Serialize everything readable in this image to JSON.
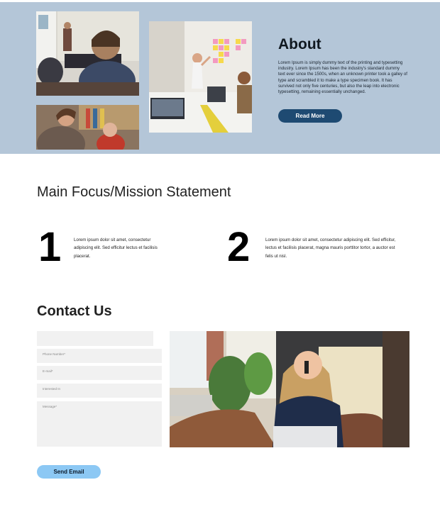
{
  "about": {
    "title": "About",
    "body": "Lorem Ipsum is simply dummy text of the printing and typesetting industry. Lorem Ipsum has been the industry's standard dummy text ever since the 1500s, when an unknown printer took a galley of type and scrambled it to make a type specimen book. It has survived not only five centuries, but also the leap into electronic typesetting, remaining essentially unchanged.",
    "button_label": "Read More"
  },
  "mission": {
    "title": "Main Focus/Mission Statement",
    "items": [
      {
        "number": "1",
        "text": "Lorem ipsum dolor sit amet, consectetur adipiscing elit. Sed efficitur lectus et facilisis placerat."
      },
      {
        "number": "2",
        "text": "Lorem ipsum dolor sit amet, consectetur adipiscing elit. Sed efficitur, lectus et facilisis placerat, magna mauris porttitor tortor, a auctor est felis ut nisl."
      }
    ]
  },
  "contact": {
    "title": "Contact Us",
    "fields": {
      "name": "",
      "phone": "Phone Number*",
      "email": "E-mail*",
      "interest": "Interested In",
      "message": "Message*"
    },
    "button_label": "Send Email"
  },
  "colors": {
    "about_bg": "#b4c6d8",
    "read_more_bg": "#1e4a72",
    "send_bg": "#8cc8f4",
    "field_bg": "#f1f1f1"
  }
}
